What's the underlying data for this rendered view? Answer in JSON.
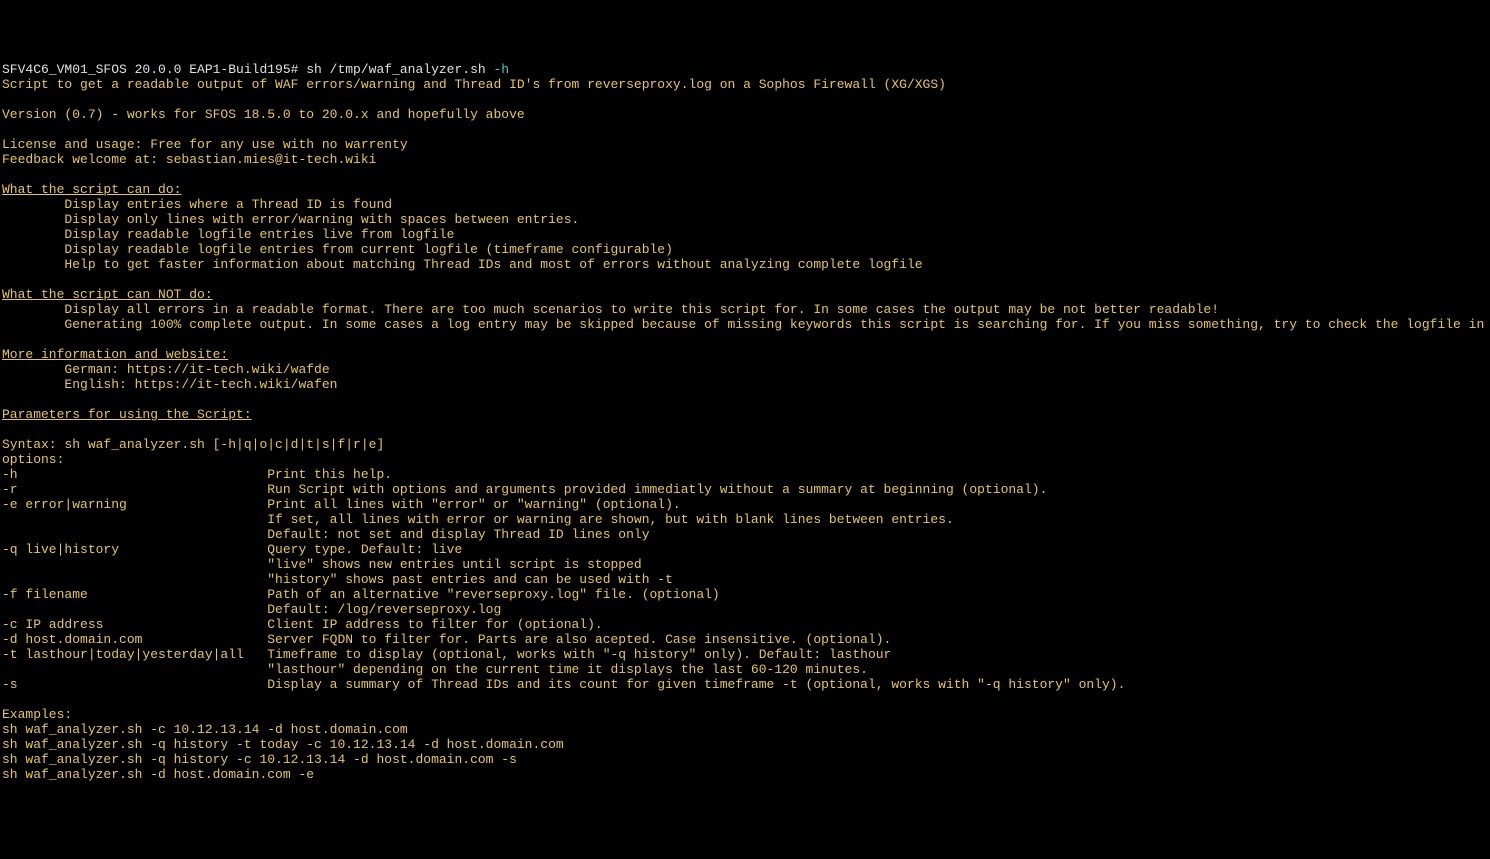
{
  "prompt": "SFV4C6_VM01_SFOS 20.0.0 EAP1-Build195# ",
  "command": "sh /tmp/waf_analyzer.sh ",
  "flag": "-h",
  "lines": {
    "desc": "Script to get a readable output of WAF errors/warning and Thread ID's from reverseproxy.log on a Sophos Firewall (XG/XGS)",
    "version": "Version (0.7) - works for SFOS 18.5.0 to 20.0.x and hopefully above",
    "license": "License and usage: Free for any use with no warrenty",
    "feedback": "Feedback welcome at: sebastian.mies@it-tech.wiki",
    "h_cando": "What the script can do:",
    "cando_1": "        Display entries where a Thread ID is found",
    "cando_2": "        Display only lines with error/warning with spaces between entries.",
    "cando_3": "        Display readable logfile entries live from logfile",
    "cando_4": "        Display readable logfile entries from current logfile (timeframe configurable)",
    "cando_5": "        Help to get faster information about matching Thread IDs and most of errors without analyzing complete logfile",
    "h_cannot": "What the script can NOT do:",
    "cannot_1": "        Display all errors in a readable format. There are too much scenarios to write this script for. In some cases the output may be not better readable!",
    "cannot_2": "        Generating 100% complete output. In some cases a log entry may be skipped because of missing keywords this script is searching for. If you miss something, try to check the logfile in traditional way.",
    "h_more": "More information and website:",
    "more_1": "        German: https://it-tech.wiki/wafde",
    "more_2": "        English: https://it-tech.wiki/wafen",
    "h_params": "Parameters for using the Script:",
    "syntax": "Syntax: sh waf_analyzer.sh [-h|q|o|c|d|t|s|f|r|e]",
    "opts": "options:",
    "o_h": "-h                                Print this help.",
    "o_r": "-r                                Run Script with options and arguments provided immediatly without a summary at beginning (optional).",
    "o_e1": "-e error|warning                  Print all lines with \"error\" or \"warning\" (optional).",
    "o_e2": "                                  If set, all lines with error or warning are shown, but with blank lines between entries.",
    "o_e3": "                                  Default: not set and display Thread ID lines only",
    "o_q1": "-q live|history                   Query type. Default: live",
    "o_q2": "                                  \"live\" shows new entries until script is stopped",
    "o_q3": "                                  \"history\" shows past entries and can be used with -t",
    "o_f1": "-f filename                       Path of an alternative \"reverseproxy.log\" file. (optional)",
    "o_f2": "                                  Default: /log/reverseproxy.log",
    "o_c": "-c IP address                     Client IP address to filter for (optional).",
    "o_d": "-d host.domain.com                Server FQDN to filter for. Parts are also acepted. Case insensitive. (optional).",
    "o_t1": "-t lasthour|today|yesterday|all   Timeframe to display (optional, works with \"-q history\" only). Default: lasthour",
    "o_t2": "                                  \"lasthour\" depending on the current time it displays the last 60-120 minutes.",
    "o_s": "-s                                Display a summary of Thread IDs and its count for given timeframe -t (optional, works with \"-q history\" only).",
    "ex": "Examples:",
    "ex1": "sh waf_analyzer.sh -c 10.12.13.14 -d host.domain.com",
    "ex2": "sh waf_analyzer.sh -q history -t today -c 10.12.13.14 -d host.domain.com",
    "ex3": "sh waf_analyzer.sh -q history -c 10.12.13.14 -d host.domain.com -s",
    "ex4": "sh waf_analyzer.sh -d host.domain.com -e"
  }
}
